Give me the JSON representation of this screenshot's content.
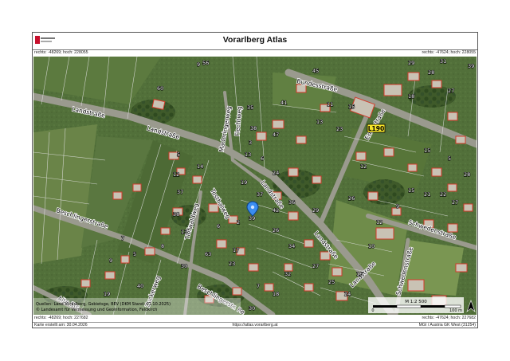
{
  "header": {
    "title": "Vorarlberg Atlas",
    "logo": "vorarlberg-logo"
  },
  "coords": {
    "top_left": "rechts: -48269; hoch: 228055",
    "top_right": "rechts: -47624; hoch: 228055",
    "bottom_left": "rechts: -48269; hoch: 227682",
    "bottom_right": "rechts: -47624; hoch: 227682"
  },
  "map": {
    "streets": {
      "bundesstrasse": "Bundesstraße",
      "landstrasse_w": "Landstraße",
      "landstrasse_c": "Landstraße",
      "landstrasse_s": "Landstraße",
      "landstrasse_se": "Landstraße",
      "landstrasse_far": "Landstraße",
      "schwedenstrasse_e": "Schwedenstraße",
      "schwedenstrasse_s": "Schwedenstraße",
      "beschlingerstrasse": "Beschlingerstraße",
      "beschlinger_s": "Beschlingerstr. Re",
      "alte_str": "Alte Str.",
      "zuckerweg": "Zuckerweg",
      "tiefwaldweg": "Tiefwaldweg",
      "tosthalweg": "Tosthalweg",
      "maderingerweg": "Maderingerweg",
      "erlenstrasse": "Erlenstraße",
      "fiechtweg": "Fiechtweg"
    },
    "road_badge": "L190",
    "marker": "location-pin",
    "house_numbers": [
      "56",
      "60",
      "41",
      "35",
      "38",
      "11",
      "13",
      "23",
      "29",
      "31",
      "39",
      "28",
      "27",
      "18",
      "15",
      "45",
      "47",
      "3",
      "9",
      "5",
      "12",
      "14",
      "13",
      "6",
      "19",
      "24",
      "37",
      "42",
      "39",
      "36",
      "37",
      "38",
      "13",
      "8",
      "5",
      "7",
      "9",
      "6",
      "2",
      "17",
      "23",
      "26",
      "34",
      "32",
      "18",
      "7",
      "30",
      "27",
      "25",
      "24",
      "16",
      "10",
      "12",
      "9",
      "15",
      "21",
      "22",
      "27",
      "15",
      "5",
      "28",
      "19",
      "40",
      "63",
      "30",
      "29",
      "12",
      "26"
    ],
    "credits_line1": "Quellen: Land Vorarlberg, Gebietsge, BEV (DKM Stand: 01.10.2025)",
    "credits_line2": "© Landesamt für Vermessung und Geoinformation, Feldkirch",
    "scale_label": "M 1:2 500",
    "scale_zero": "0",
    "scale_end": "100 m",
    "north_icon": "north-arrow",
    "colors": {
      "parcel_line": "#e2e2e2",
      "building_outline": "#d23a2a",
      "road_fill": "#9a9a8e",
      "badge_fill": "#f7e52a"
    }
  },
  "footer": {
    "created": "Karte erstellt am: 30.04.2026",
    "url": "https://atlas.vorarlberg.at",
    "crs": "MGI / Austria GK West (31254)"
  }
}
